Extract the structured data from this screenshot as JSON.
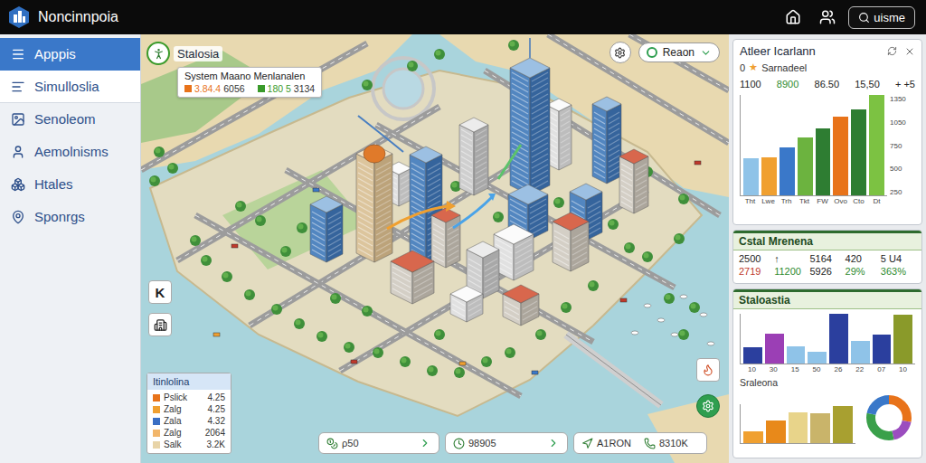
{
  "app": {
    "title": "Noncinnpoia"
  },
  "topbar": {
    "search_label": "uisme"
  },
  "sidebar": {
    "items": [
      {
        "label": "Apppis",
        "selected": true,
        "hovered": false
      },
      {
        "label": "Simulloslia",
        "selected": false,
        "hovered": true
      },
      {
        "label": "Senoleom",
        "selected": false,
        "hovered": false
      },
      {
        "label": "Aemolnisms",
        "selected": false,
        "hovered": false
      },
      {
        "label": "Htales",
        "selected": false,
        "hovered": false
      },
      {
        "label": "Sponrgs",
        "selected": false,
        "hovered": false
      }
    ]
  },
  "map": {
    "info_card": {
      "title": "Stalosia",
      "subtitle": "System Maano Menlanalen",
      "entries": [
        {
          "value": "3.84.4",
          "detail": "6056",
          "color": "#e8731a"
        },
        {
          "value": "180 5",
          "detail": "3134",
          "color": "#3a9a2a"
        }
      ]
    },
    "dropdown": {
      "value": "Reaon"
    },
    "tool_button": {
      "label": "K"
    },
    "legend": {
      "title": "Itinlolina",
      "rows": [
        {
          "label": "Pslick",
          "value": "4.25",
          "color": "#e8731a"
        },
        {
          "label": "Zalg",
          "value": "4.25",
          "color": "#f0a030"
        },
        {
          "label": "Zala",
          "value": "4.32",
          "color": "#3a6fc4"
        },
        {
          "label": "Zalg",
          "value": "2064",
          "color": "#f2b66a"
        },
        {
          "label": "Salk",
          "value": "3.2K",
          "color": "#e8d4a8"
        }
      ]
    },
    "bottom_pills": [
      {
        "items": [
          "ρ50"
        ],
        "chevron": true
      },
      {
        "items": [
          "98905"
        ],
        "chevron": true
      },
      {
        "items": [
          "A1RON",
          "8310K"
        ],
        "chevron": false
      }
    ]
  },
  "panel": {
    "chart_card": {
      "title": "Atleer Icarlann",
      "marker": "0",
      "star": "★",
      "subtitle": "Sarnadeel",
      "stats": [
        {
          "text": "1100",
          "color": "#222222"
        },
        {
          "text": "8900",
          "color": "#2e8b2e"
        },
        {
          "text": "86.50",
          "color": "#222222"
        },
        {
          "text": "15,50",
          "color": "#222222"
        },
        {
          "text": "+ +5",
          "color": "#222222"
        }
      ],
      "axis": {
        "max": 1500,
        "ticks": [
          "1350",
          "1050",
          "750",
          "500",
          "250"
        ]
      },
      "bars": [
        {
          "label": "Tht",
          "value": 560,
          "color": "#8fc3e8"
        },
        {
          "label": "Lwe",
          "value": 570,
          "color": "#f0a030"
        },
        {
          "label": "Trh",
          "value": 720,
          "color": "#3a78c9"
        },
        {
          "label": "Tkt",
          "value": 860,
          "color": "#6cb33f"
        },
        {
          "label": "FW",
          "value": 1000,
          "color": "#2e7d32"
        },
        {
          "label": "Ovo",
          "value": 1180,
          "color": "#e8731a"
        },
        {
          "label": "Cto",
          "value": 1280,
          "color": "#2e7d32"
        },
        {
          "label": "Dt",
          "value": 1500,
          "color": "#7cc242"
        }
      ]
    },
    "metrics_card": {
      "title": "Cstal Mrenena",
      "rows": [
        [
          {
            "text": "2500",
            "color": "#222222"
          },
          {
            "text": "↑",
            "color": "#222222"
          },
          {
            "text": "5164",
            "color": "#222222"
          },
          {
            "text": "420",
            "color": "#222222"
          },
          {
            "text": "5 U4",
            "color": "#222222"
          }
        ],
        [
          {
            "text": "2719",
            "color": "#c0392b"
          },
          {
            "text": "11200",
            "color": "#2e8b2e"
          },
          {
            "text": "5926",
            "color": "#222222"
          },
          {
            "text": "29%",
            "color": "#2e8b2e"
          },
          {
            "text": "363%",
            "color": "#2e8b2e"
          }
        ]
      ]
    },
    "stats_card": {
      "title": "Staloastia",
      "max": 100,
      "bars": [
        {
          "label": "10",
          "value": 32,
          "color": "#2b3f9e"
        },
        {
          "label": "30",
          "value": 60,
          "color": "#9b3fb5"
        },
        {
          "label": "15",
          "value": 34,
          "color": "#8fc3e8"
        },
        {
          "label": "50",
          "value": 24,
          "color": "#8fc3e8"
        },
        {
          "label": "26",
          "value": 100,
          "color": "#2b3f9e"
        },
        {
          "label": "22",
          "value": 45,
          "color": "#8fc3e8"
        },
        {
          "label": "07",
          "value": 58,
          "color": "#2b3f9e"
        },
        {
          "label": "10",
          "value": 98,
          "color": "#8a9a2a"
        }
      ],
      "sub_title": "Sraleona",
      "sub_max": 100,
      "sub_bars": [
        {
          "value": 30,
          "color": "#f0a030"
        },
        {
          "value": 58,
          "color": "#e8891a"
        },
        {
          "value": 78,
          "color": "#e8d48a"
        },
        {
          "value": 76,
          "color": "#c9b46a"
        },
        {
          "value": 96,
          "color": "#a8a030"
        }
      ],
      "donut": [
        {
          "value": 28,
          "color": "#e8731a"
        },
        {
          "value": 18,
          "color": "#9b4dbf"
        },
        {
          "value": 32,
          "color": "#3aa04a"
        },
        {
          "value": 22,
          "color": "#3a78c9"
        }
      ]
    }
  }
}
